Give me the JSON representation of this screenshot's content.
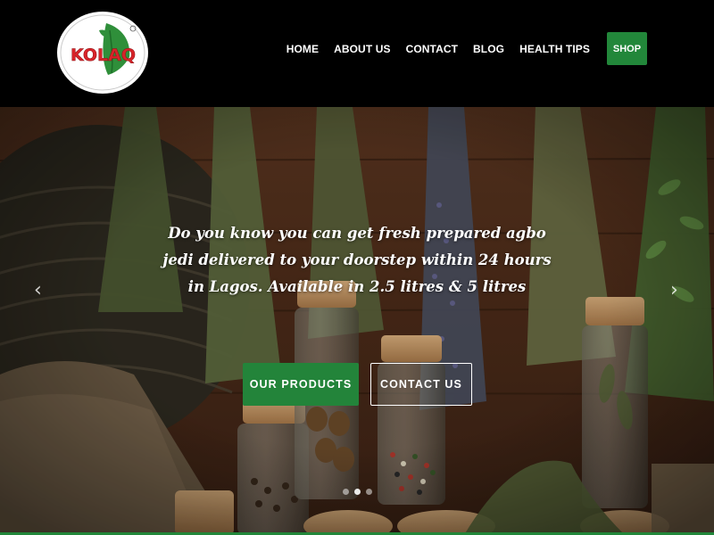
{
  "brand": {
    "logo_text": "KOLAQ",
    "colors": {
      "red": "#d8242a",
      "green": "#2f8f3a",
      "white": "#ffffff"
    }
  },
  "nav": {
    "items": [
      {
        "label": "HOME"
      },
      {
        "label": "ABOUT US"
      },
      {
        "label": "CONTACT"
      },
      {
        "label": "BLOG"
      },
      {
        "label": "HEALTH TIPS"
      }
    ],
    "shop_label": "SHOP"
  },
  "hero": {
    "headline": "Do you know you can get fresh prepared agbo jedi delivered to your doorstep within 24 hours in Lagos. Available in 2.5 litres & 5 litres",
    "primary_button": "OUR PRODUCTS",
    "secondary_button": "CONTACT US",
    "prev_icon": "chevron-left-icon",
    "next_icon": "chevron-right-icon",
    "slides_count": 3,
    "active_slide": 1
  },
  "theme": {
    "accent": "#22873a",
    "header_bg": "#000000",
    "hero_text": "#ffffff"
  }
}
